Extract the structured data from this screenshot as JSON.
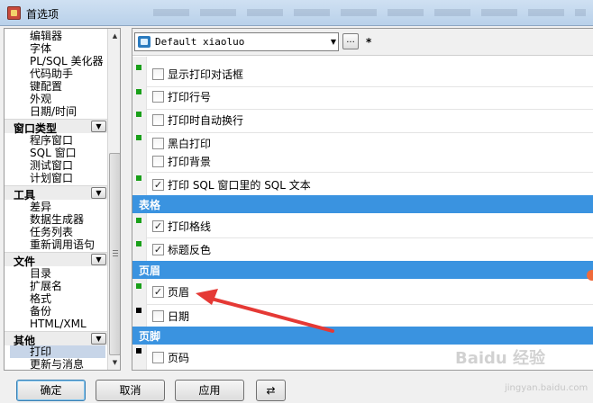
{
  "window": {
    "title": "首选项"
  },
  "tree": {
    "items_top": [
      "编辑器",
      "字体",
      "PL/SQL 美化器",
      "代码助手",
      "键配置",
      "外观",
      "日期/时间"
    ],
    "groups": [
      {
        "label": "窗口类型",
        "items": [
          "程序窗口",
          "SQL 窗口",
          "测试窗口",
          "计划窗口"
        ]
      },
      {
        "label": "工具",
        "items": [
          "差异",
          "数据生成器",
          "任务列表",
          "重新调用语句"
        ]
      },
      {
        "label": "文件",
        "items": [
          "目录",
          "扩展名",
          "格式",
          "备份",
          "HTML/XML"
        ]
      },
      {
        "label": "其他",
        "items": [
          "打印",
          "更新与消息"
        ],
        "selected": "打印"
      }
    ]
  },
  "toolbar": {
    "profile": "Default xiaoluo",
    "more": "...",
    "modified_marker": "*"
  },
  "options": {
    "show_print_dialog": {
      "label": "显示打印对话框",
      "checked": false,
      "marker": "green"
    },
    "print_line_numbers": {
      "label": "打印行号",
      "checked": false,
      "marker": "green"
    },
    "auto_wrap": {
      "label": "打印时自动换行",
      "checked": false,
      "marker": "green"
    },
    "bw_print": {
      "label": "黑白打印",
      "checked": false,
      "marker": "green"
    },
    "print_background": {
      "label": "打印背景",
      "checked": false,
      "marker": "none"
    },
    "print_sql_text": {
      "label": "打印 SQL 窗口里的 SQL 文本",
      "checked": true,
      "marker": "green"
    }
  },
  "sections": {
    "table": {
      "title": "表格",
      "options": {
        "gridlines": {
          "label": "打印格线",
          "checked": true,
          "marker": "green"
        },
        "header_inverse": {
          "label": "标题反色",
          "checked": true,
          "marker": "green"
        }
      }
    },
    "header": {
      "title": "页眉",
      "options": {
        "page_header": {
          "label": "页眉",
          "checked": true,
          "marker": "green"
        },
        "date": {
          "label": "日期",
          "checked": false,
          "marker": "black"
        }
      }
    },
    "footer": {
      "title": "页脚",
      "options": {
        "page_number": {
          "label": "页码",
          "checked": false,
          "marker": "black"
        }
      }
    }
  },
  "buttons": {
    "ok": "确定",
    "cancel": "取消",
    "apply": "应用"
  },
  "watermark": {
    "main": "Baidu 经验",
    "sub": "jingyan.baidu.com"
  },
  "colors": {
    "section_header": "#3a93e0",
    "marker_green": "#1aa01a",
    "annotation_arrow": "#e53935"
  }
}
